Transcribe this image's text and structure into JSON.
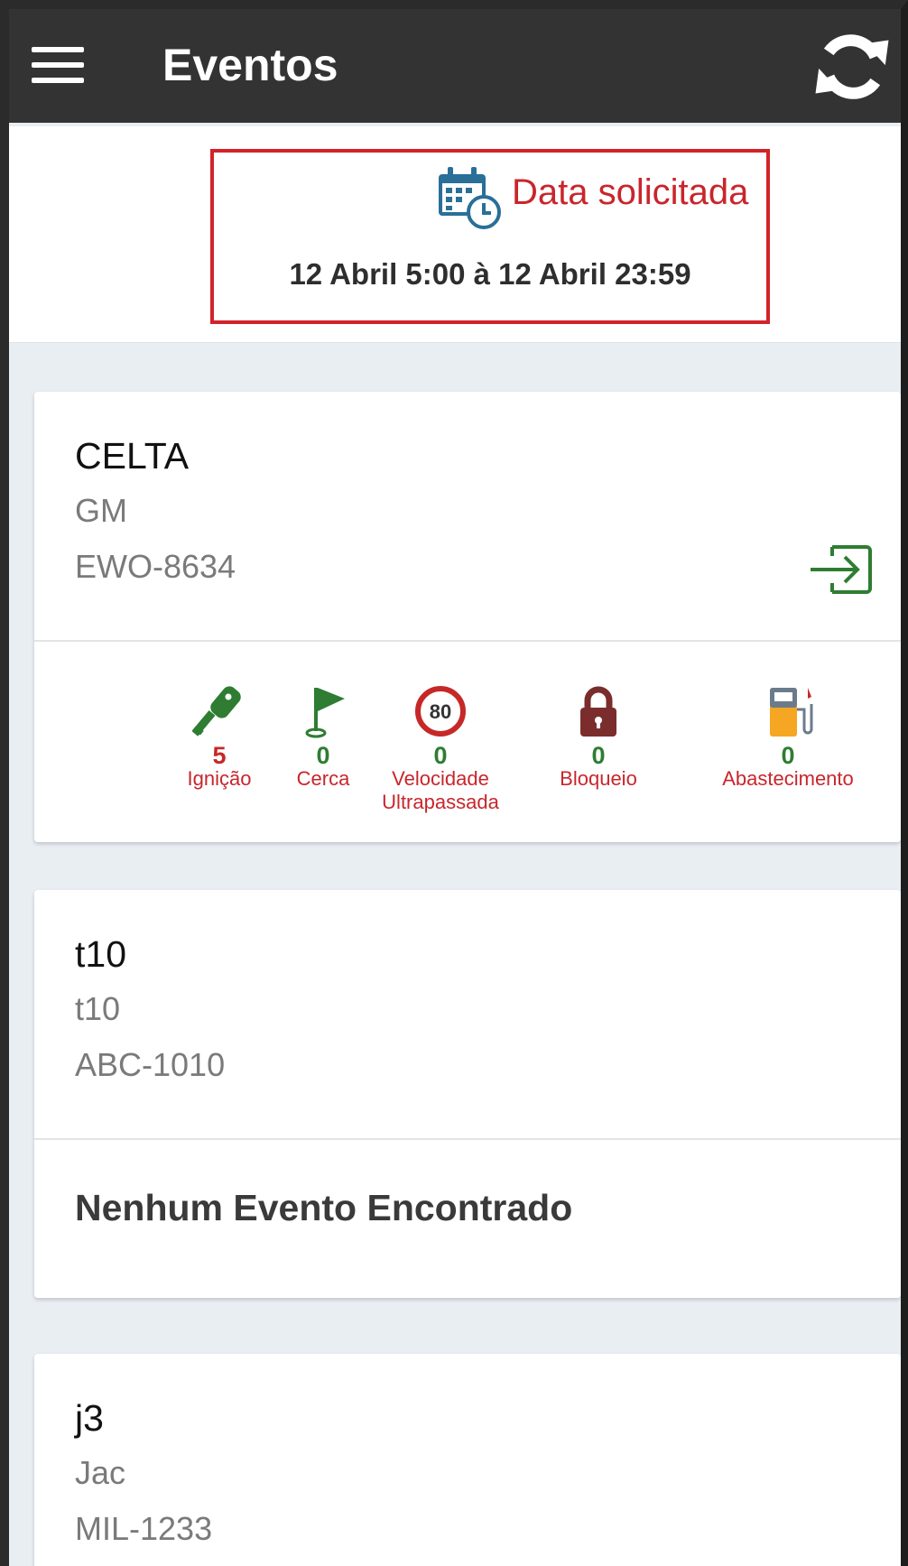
{
  "header": {
    "title": "Eventos"
  },
  "date_filter": {
    "label": "Data solicitada",
    "range": "12 Abril 5:00 à 12 Abril 23:59"
  },
  "colors": {
    "appbar": "#333333",
    "highlight_red": "#d2232a",
    "green": "#2e7d32",
    "count_red": "#c62828"
  },
  "vehicles": [
    {
      "model": "CELTA",
      "brand": "GM",
      "plate": "EWO-8634",
      "events": [
        {
          "count": "5",
          "label": "Ignição",
          "icon": "key-icon"
        },
        {
          "count": "0",
          "label": "Cerca",
          "icon": "flag-icon"
        },
        {
          "count": "0",
          "label": "Velocidade Ultrapassada",
          "icon": "speed-limit-icon",
          "speed": "80"
        },
        {
          "count": "0",
          "label": "Bloqueio",
          "icon": "padlock-icon"
        },
        {
          "count": "0",
          "label": "Abastecimento",
          "icon": "fuel-pump-icon"
        }
      ]
    },
    {
      "model": "t10",
      "brand": "t10",
      "plate": "ABC-1010",
      "empty_message": "Nenhum Evento Encontrado"
    },
    {
      "model": "j3",
      "brand": "Jac",
      "plate": "MIL-1233"
    }
  ]
}
